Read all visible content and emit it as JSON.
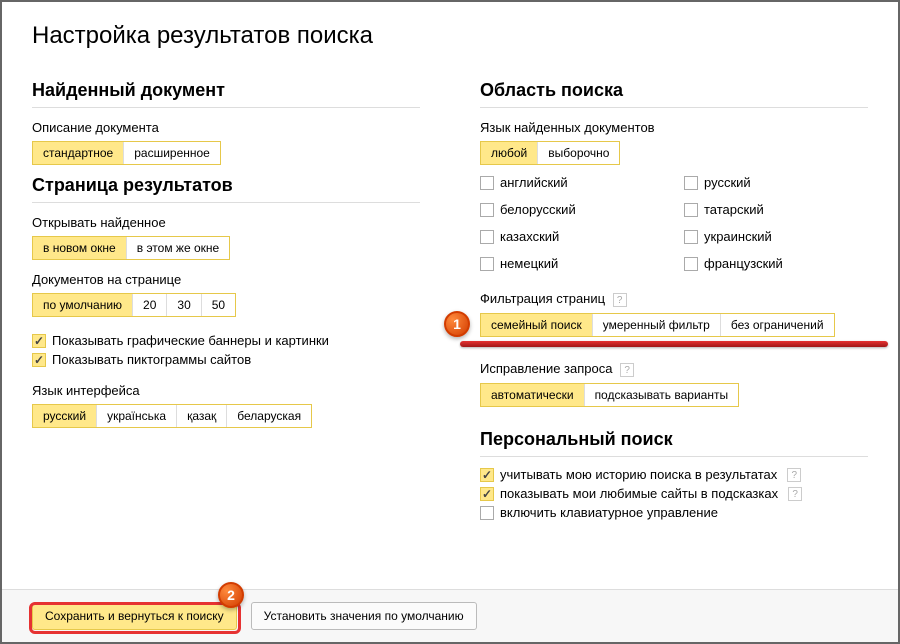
{
  "title": "Настройка результатов поиска",
  "left": {
    "found_doc": {
      "heading": "Найденный документ",
      "desc_label": "Описание документа",
      "options": [
        "стандартное",
        "расширенное"
      ],
      "selectedIndex": 0
    },
    "results_page": {
      "heading": "Страница результатов",
      "open_label": "Открывать найденное",
      "open_options": [
        "в новом окне",
        "в этом же окне"
      ],
      "open_selectedIndex": 0,
      "perpage_label": "Документов на странице",
      "perpage_options": [
        "по умолчанию",
        "20",
        "30",
        "50"
      ],
      "perpage_selectedIndex": 0,
      "show_banners": "Показывать графические баннеры и картинки",
      "show_favicons": "Показывать пиктограммы сайтов",
      "iface_lang_label": "Язык интерфейса",
      "iface_lang_options": [
        "русский",
        "українська",
        "қазақ",
        "беларуская"
      ],
      "iface_lang_selectedIndex": 0
    }
  },
  "right": {
    "scope": {
      "heading": "Область поиска",
      "lang_label": "Язык найденных документов",
      "lang_mode_options": [
        "любой",
        "выборочно"
      ],
      "lang_mode_selectedIndex": 0,
      "langs_left": [
        "английский",
        "белорусский",
        "казахский",
        "немецкий"
      ],
      "langs_right": [
        "русский",
        "татарский",
        "украинский",
        "французский"
      ],
      "filter_label": "Фильтрация страниц",
      "filter_options": [
        "семейный поиск",
        "умеренный фильтр",
        "без ограничений"
      ],
      "filter_selectedIndex": 0,
      "spell_label": "Исправление запроса",
      "spell_options": [
        "автоматически",
        "подсказывать варианты"
      ],
      "spell_selectedIndex": 0
    },
    "personal": {
      "heading": "Персональный поиск",
      "history": "учитывать мою историю поиска в результатах",
      "favs": "показывать мои любимые сайты в подсказках",
      "kbd": "включить клавиатурное управление"
    }
  },
  "footer": {
    "save": "Сохранить и вернуться к поиску",
    "reset": "Установить значения по умолчанию"
  },
  "markers": {
    "one": "1",
    "two": "2"
  }
}
